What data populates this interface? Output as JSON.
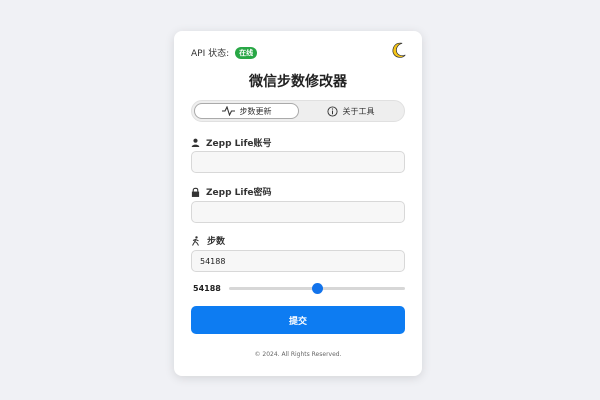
{
  "status": {
    "label": "API 状态:",
    "badge": "在线",
    "badge_color": "#28a745"
  },
  "theme_toggle_icon": "moon-icon",
  "title": "微信步数修改器",
  "tabs": [
    {
      "label": "步数更新",
      "icon": "pulse-icon",
      "active": true
    },
    {
      "label": "关于工具",
      "icon": "info-icon",
      "active": false
    }
  ],
  "fields": {
    "account": {
      "label": "Zepp Life账号",
      "value": "",
      "icon": "user-icon"
    },
    "password": {
      "label": "Zepp Life密码",
      "value": "",
      "icon": "lock-icon"
    },
    "steps": {
      "label": "步数",
      "value": "54188",
      "icon": "walk-icon"
    }
  },
  "slider": {
    "value_label": "54188",
    "fraction": 0.5
  },
  "submit_label": "提交",
  "footer": "© 2024. All Rights Reserved.",
  "colors": {
    "primary": "#0d7cf2",
    "background": "#f0f1f5"
  }
}
